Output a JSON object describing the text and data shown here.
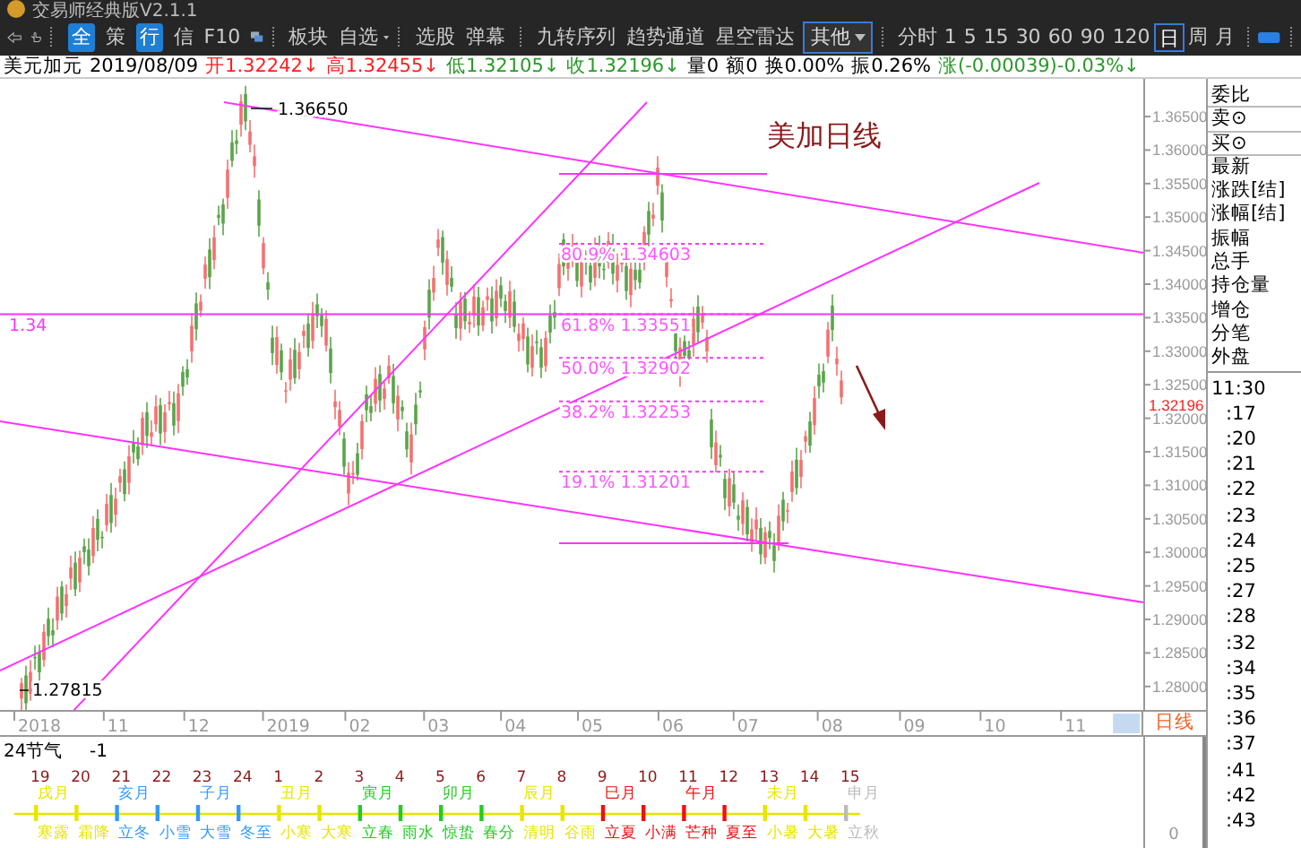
{
  "window": {
    "title": "交易师经典版V2.1.1"
  },
  "toolbar": {
    "quick": [
      {
        "label": "全",
        "kind": "badge"
      },
      {
        "label": "策",
        "kind": "plain"
      },
      {
        "label": "行",
        "kind": "badge"
      },
      {
        "label": "信",
        "kind": "plain"
      },
      {
        "label": "F10",
        "kind": "plain"
      }
    ],
    "tools": [
      {
        "label": "板块",
        "kind": "plain"
      },
      {
        "label": "自选",
        "kind": "menu"
      },
      {
        "label": "选股",
        "kind": "plain"
      },
      {
        "label": "弹幕",
        "kind": "plain"
      },
      {
        "label": "九转序列",
        "kind": "plain"
      },
      {
        "label": "趋势通道",
        "kind": "plain"
      },
      {
        "label": "星空雷达",
        "kind": "plain"
      }
    ],
    "indicator_select": {
      "value": "其他"
    },
    "periods": [
      {
        "label": "分时",
        "selected": false
      },
      {
        "label": "1",
        "selected": false
      },
      {
        "label": "5",
        "selected": false
      },
      {
        "label": "15",
        "selected": false
      },
      {
        "label": "30",
        "selected": false
      },
      {
        "label": "60",
        "selected": false
      },
      {
        "label": "90",
        "selected": false
      },
      {
        "label": "120",
        "selected": false
      },
      {
        "label": "日",
        "selected": true
      },
      {
        "label": "周",
        "selected": false
      },
      {
        "label": "月",
        "selected": false
      }
    ]
  },
  "info_bar": {
    "symbol": "美元加元",
    "date": "2019/08/09",
    "fields": [
      {
        "text": "开1.32242↓",
        "color": "#ff2020"
      },
      {
        "text": "高1.32455↓",
        "color": "#ff2020"
      },
      {
        "text": "低1.32105↓",
        "color": "#2a9a2a"
      },
      {
        "text": "收1.32196↓",
        "color": "#2a9a2a"
      },
      {
        "text": "量0",
        "color": "#000000"
      },
      {
        "text": "额0",
        "color": "#000000"
      },
      {
        "text": "换0.00%",
        "color": "#000000"
      },
      {
        "text": "振0.26%",
        "color": "#000000"
      },
      {
        "text": "涨(-0.00039)-0.03%↓",
        "color": "#2a9a2a"
      }
    ]
  },
  "chart": {
    "annotation": "美加日线",
    "high_label": "1.36650",
    "low_label": "1.27815",
    "line_label": "1.34",
    "last_price": "1.32196",
    "fib_levels": [
      "80.9% 1.34603",
      "61.8% 1.33551",
      "50.0% 1.32902",
      "38.2% 1.32253",
      "19.1% 1.31201"
    ],
    "price_ticks": [
      "1.36500",
      "1.36000",
      "1.35500",
      "1.35000",
      "1.34500",
      "1.34000",
      "1.33500",
      "1.33000",
      "1.32500",
      "1.32000",
      "1.31500",
      "1.31000",
      "1.30500",
      "1.30000",
      "1.29500",
      "1.29000",
      "1.28500",
      "1.28000"
    ],
    "x_ticks": [
      "2018",
      "11",
      "12",
      "2019",
      "02",
      "03",
      "04",
      "05",
      "06",
      "07",
      "08",
      "09",
      "10",
      "11"
    ]
  },
  "side_panel": {
    "fields": [
      "委比",
      "卖⊙",
      "买⊙",
      "最新",
      "涨跌[结]",
      "涨幅[结]",
      "振幅",
      "总手",
      "持仓量",
      "增仓",
      "分笔",
      "外盘"
    ],
    "ticks": [
      "11:30",
      ":17",
      ":20",
      ":21",
      ":22",
      ":23",
      ":24",
      ":25",
      ":27",
      ":28",
      ":32",
      ":34",
      ":35",
      ":36",
      ":37",
      ":41",
      ":42",
      ":43"
    ]
  },
  "subchart": {
    "tab": "日线",
    "title": "24节气",
    "param": "-1",
    "axis_value": "0",
    "terms": [
      {
        "number": "19",
        "month": "戌月",
        "name": "寒露",
        "color": "#e6e600"
      },
      {
        "number": "20",
        "name": "霜降",
        "color": "#e6e600"
      },
      {
        "number": "21",
        "month": "亥月",
        "name": "立冬",
        "color": "#3399ff"
      },
      {
        "number": "22",
        "name": "小雪",
        "color": "#3399ff"
      },
      {
        "number": "23",
        "month": "子月",
        "name": "大雪",
        "color": "#3399ff"
      },
      {
        "number": "24",
        "name": "冬至",
        "color": "#3399ff"
      },
      {
        "number": "1",
        "month": "丑月",
        "name": "小寒",
        "color": "#e6e600"
      },
      {
        "number": "2",
        "name": "大寒",
        "color": "#e6e600"
      },
      {
        "number": "3",
        "month": "寅月",
        "name": "立春",
        "color": "#22cc22"
      },
      {
        "number": "4",
        "name": "雨水",
        "color": "#22cc22"
      },
      {
        "number": "5",
        "month": "卯月",
        "name": "惊蛰",
        "color": "#22cc22"
      },
      {
        "number": "6",
        "name": "春分",
        "color": "#22cc22"
      },
      {
        "number": "7",
        "month": "辰月",
        "name": "清明",
        "color": "#e6e600"
      },
      {
        "number": "8",
        "name": "谷雨",
        "color": "#e6e600"
      },
      {
        "number": "9",
        "month": "巳月",
        "name": "立夏",
        "color": "#ee1111"
      },
      {
        "number": "10",
        "name": "小满",
        "color": "#ee1111"
      },
      {
        "number": "11",
        "month": "午月",
        "name": "芒种",
        "color": "#ee1111"
      },
      {
        "number": "12",
        "name": "夏至",
        "color": "#ee1111"
      },
      {
        "number": "13",
        "month": "未月",
        "name": "小暑",
        "color": "#e6e600"
      },
      {
        "number": "14",
        "name": "大暑",
        "color": "#e6e600"
      },
      {
        "number": "15",
        "month": "申月",
        "name": "立秋",
        "color": "#bbbbbb"
      }
    ]
  }
}
